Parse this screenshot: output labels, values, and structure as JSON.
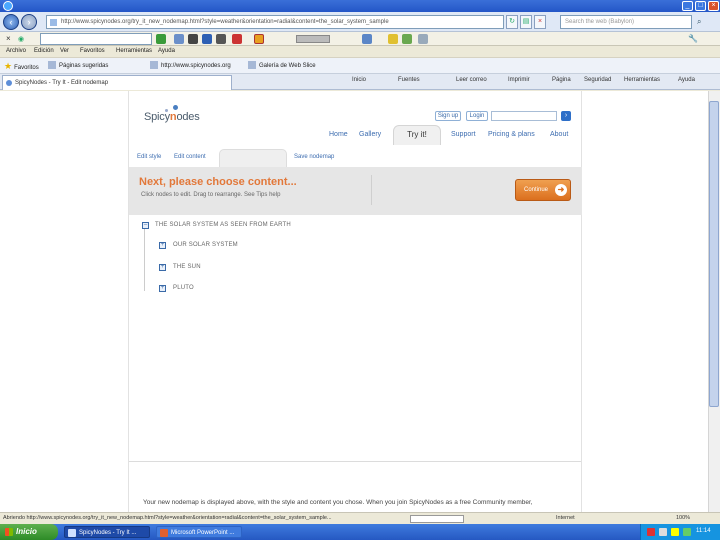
{
  "browser": {
    "address": "http://www.spicynodes.org/try_it_new_nodemap.html?style=weather&orientation=radial&content=the_solar_system_sample",
    "search_placeholder": "Search the web (Babylon)",
    "menu": [
      "Archivo",
      "Edición",
      "Ver",
      "Favoritos",
      "Herramientas",
      "Ayuda"
    ],
    "favorites_label": "Favoritos",
    "favorites": [
      "Páginas sugeridas",
      "http://www.spicynodes.org",
      "Galería de Web Slice"
    ],
    "tab_title": "SpicyNodes - Try It - Edit nodemap",
    "commands": [
      "Inicio",
      "Fuentes",
      "Leer correo",
      "Imprimir",
      "Página",
      "Seguridad",
      "Herramientas",
      "Ayuda"
    ]
  },
  "site": {
    "logo_left": "Spicy",
    "logo_n": "n",
    "logo_right": "odes",
    "signup": "Sign up",
    "login": "Login",
    "nav": [
      "Home",
      "Gallery",
      "Try it!",
      "Support",
      "Pricing & plans",
      "About"
    ],
    "subtabs": [
      "Edit style",
      "Edit content",
      "Save nodemap"
    ],
    "banner_title": "Next, please choose content...",
    "banner_sub": "Click nodes to edit. Drag to rearrange. See Tips  help",
    "continue": "Continue",
    "tree": {
      "root": "THE SOLAR SYSTEM AS SEEN FROM EARTH",
      "children": [
        "OUR SOLAR SYSTEM",
        "THE SUN",
        "PLUTO"
      ]
    },
    "footer": "Your new nodemap is displayed above, with the style and content you chose. When you join SpicyNodes as a free Community member,"
  },
  "status": {
    "text": "Abriendo http://www.spicynodes.org/try_it_new_nodemap.html?style=weather&orientation=radial&content=the_solar_system_sample...",
    "zone": "Internet",
    "zoom": "100%"
  },
  "taskbar": {
    "start": "Inicio",
    "items": [
      "SpicyNodes - Try It ...",
      "Microsoft PowerPoint ..."
    ],
    "clock": "11:14"
  }
}
